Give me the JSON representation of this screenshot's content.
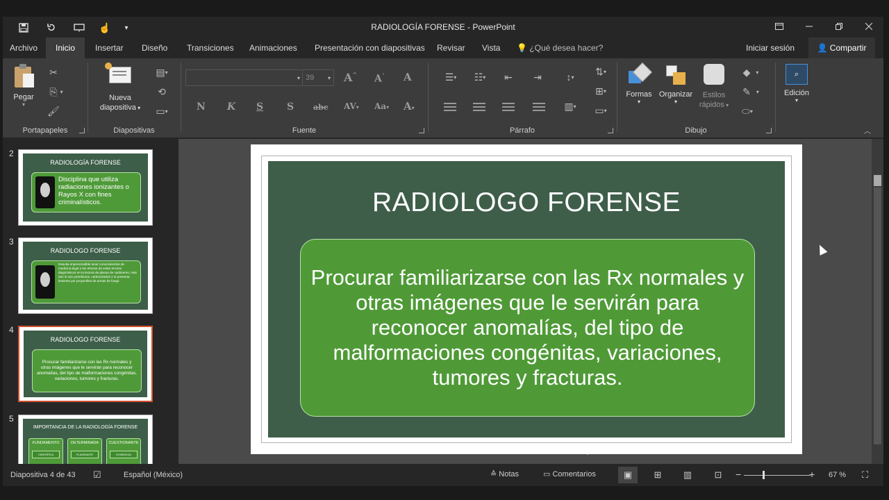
{
  "app": {
    "title": "RADIOLOGÍA FORENSE - PowerPoint",
    "tell_me_placeholder": "¿Qué desea hacer?",
    "sign_in": "Iniciar sesión",
    "share": "Compartir"
  },
  "tabs": [
    "Archivo",
    "Inicio",
    "Insertar",
    "Diseño",
    "Transiciones",
    "Animaciones",
    "Presentación con diapositivas",
    "Revisar",
    "Vista"
  ],
  "ribbon": {
    "portapapeles": {
      "label": "Portapapeles",
      "paste": "Pegar"
    },
    "diapositivas": {
      "label": "Diapositivas",
      "new_slide_line1": "Nueva",
      "new_slide_line2": "diapositiva"
    },
    "fuente": {
      "label": "Fuente",
      "font_name": "",
      "font_size": "39"
    },
    "parrafo": {
      "label": "Párrafo"
    },
    "dibujo": {
      "label": "Dibujo",
      "shapes": "Formas",
      "arrange": "Organizar",
      "quick_styles_line1": "Estilos",
      "quick_styles_line2": "rápidos"
    },
    "edicion": {
      "label": "Edición"
    }
  },
  "thumbnails": [
    {
      "number": "2",
      "title": "RADIOLOGÍA FORENSE",
      "text": "Disciplina que utiliza radiaciones ionizantes o Rayos X con fines criminalísticos."
    },
    {
      "number": "3",
      "title": "RADIOLOGO FORENSE",
      "text": "Resulta imprescindible tener conocimientos de medicina legal o los efectos de evitar errores diagnósticos en la lectura de placas de cadáveres, más aún si son putrefactos, carbonizados o si presenta lesiones por proyectiles de armas de fuego"
    },
    {
      "number": "4",
      "title": "RADIOLOGO FORENSE",
      "text": "Procurar familiarizarse con las Rx normales y otras imágenes que le servirán para reconocer anomalías, del tipo de malformaciones congénitas, variaciones, tumores y fracturas."
    },
    {
      "number": "5",
      "title": "IMPORTANCIA DE LA RADIOLOGÍA FORENSE",
      "boxes": [
        "FUNDAMENTO",
        "DETERMINADA",
        "CUESTIONANTE"
      ],
      "subboxes": [
        "CIENTÍFICA",
        "FLAGRANTE",
        "EVIDENCIA"
      ]
    }
  ],
  "slide": {
    "title": "RADIOLOGO FORENSE",
    "body": "Procurar familiarizarse con las Rx normales y otras imágenes que le servirán para reconocer anomalías, del tipo de malformaciones congénitas, variaciones, tumores y fracturas."
  },
  "status": {
    "slide_counter": "Diapositiva 4 de 43",
    "language": "Español (México)",
    "notes": "Notas",
    "comments": "Comentarios",
    "zoom": "67 %"
  }
}
